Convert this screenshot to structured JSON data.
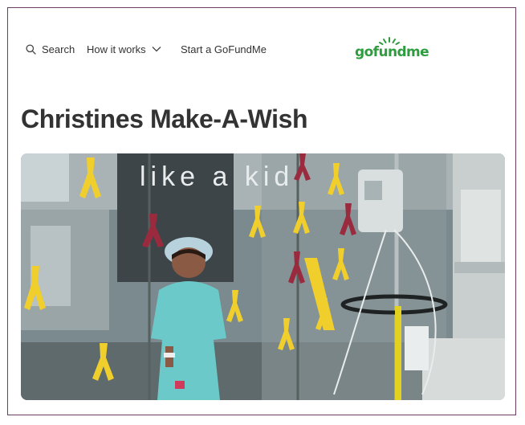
{
  "nav": {
    "search_label": "Search",
    "how_label": "How it works",
    "start_label": "Start a GoFundMe"
  },
  "logo": {
    "text": "gofundme",
    "color": "#2e9c3f"
  },
  "campaign": {
    "title": "Christines Make-A-Wish",
    "hero_window_text": "like a kid"
  },
  "colors": {
    "frame_border": "#6b3d63",
    "ribbon_yellow": "#f0cf2c",
    "ribbon_red": "#9a2a3e",
    "gown": "#6cc9c9"
  }
}
